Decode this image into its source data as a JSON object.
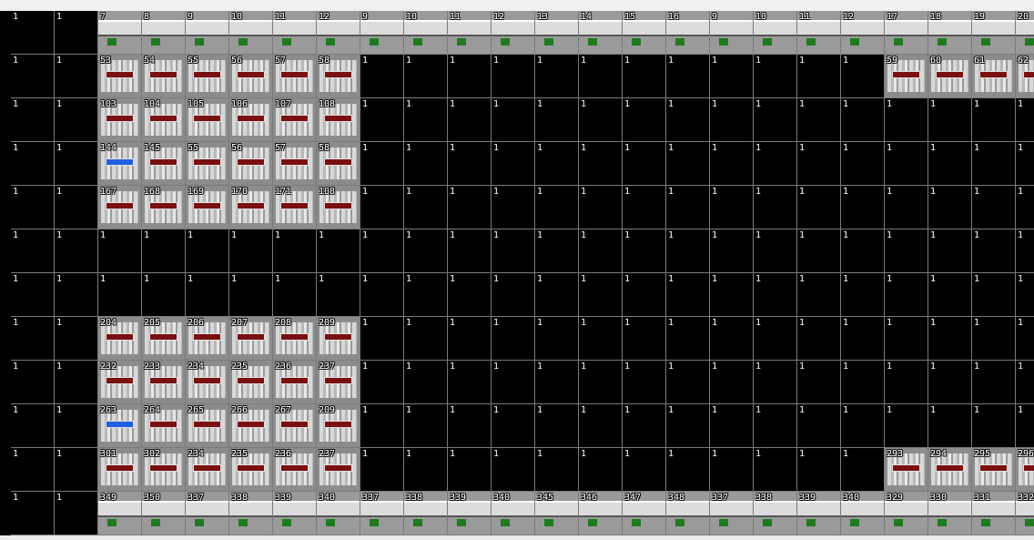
{
  "map": {
    "columns": 24,
    "rows": 12,
    "tiles": [
      [
        "1",
        "1",
        "7",
        "8",
        "9",
        "10",
        "11",
        "12",
        "9",
        "10",
        "11",
        "12",
        "13",
        "14",
        "15",
        "16",
        "9",
        "10",
        "11",
        "12",
        "17",
        "18",
        "19",
        "20"
      ],
      [
        "1",
        "1",
        "53",
        "54",
        "55",
        "56",
        "57",
        "58",
        "1",
        "1",
        "1",
        "1",
        "1",
        "1",
        "1",
        "1",
        "1",
        "1",
        "1",
        "1",
        "59",
        "60",
        "61",
        "62"
      ],
      [
        "1",
        "1",
        "103",
        "104",
        "105",
        "106",
        "107",
        "108",
        "1",
        "1",
        "1",
        "1",
        "1",
        "1",
        "1",
        "1",
        "1",
        "1",
        "1",
        "1",
        "1",
        "1",
        "1",
        "1"
      ],
      [
        "1",
        "1",
        "144",
        "145",
        "55",
        "56",
        "57",
        "58",
        "1",
        "1",
        "1",
        "1",
        "1",
        "1",
        "1",
        "1",
        "1",
        "1",
        "1",
        "1",
        "1",
        "1",
        "1",
        "1"
      ],
      [
        "1",
        "1",
        "167",
        "168",
        "169",
        "170",
        "171",
        "108",
        "1",
        "1",
        "1",
        "1",
        "1",
        "1",
        "1",
        "1",
        "1",
        "1",
        "1",
        "1",
        "1",
        "1",
        "1",
        "1"
      ],
      [
        "1",
        "1",
        "1",
        "1",
        "1",
        "1",
        "1",
        "1",
        "1",
        "1",
        "1",
        "1",
        "1",
        "1",
        "1",
        "1",
        "1",
        "1",
        "1",
        "1",
        "1",
        "1",
        "1",
        "1"
      ],
      [
        "1",
        "1",
        "1",
        "1",
        "1",
        "1",
        "1",
        "1",
        "1",
        "1",
        "1",
        "1",
        "1",
        "1",
        "1",
        "1",
        "1",
        "1",
        "1",
        "1",
        "1",
        "1",
        "1",
        "1"
      ],
      [
        "1",
        "1",
        "204",
        "205",
        "206",
        "207",
        "208",
        "209",
        "1",
        "1",
        "1",
        "1",
        "1",
        "1",
        "1",
        "1",
        "1",
        "1",
        "1",
        "1",
        "1",
        "1",
        "1",
        "1"
      ],
      [
        "1",
        "1",
        "232",
        "233",
        "234",
        "235",
        "236",
        "237",
        "1",
        "1",
        "1",
        "1",
        "1",
        "1",
        "1",
        "1",
        "1",
        "1",
        "1",
        "1",
        "1",
        "1",
        "1",
        "1"
      ],
      [
        "1",
        "1",
        "263",
        "264",
        "265",
        "266",
        "267",
        "209",
        "1",
        "1",
        "1",
        "1",
        "1",
        "1",
        "1",
        "1",
        "1",
        "1",
        "1",
        "1",
        "1",
        "1",
        "1",
        "1"
      ],
      [
        "1",
        "1",
        "301",
        "302",
        "234",
        "235",
        "236",
        "237",
        "1",
        "1",
        "1",
        "1",
        "1",
        "1",
        "1",
        "1",
        "1",
        "1",
        "1",
        "1",
        "293",
        "294",
        "295",
        "296"
      ],
      [
        "1",
        "1",
        "349",
        "350",
        "337",
        "338",
        "339",
        "340",
        "337",
        "338",
        "339",
        "340",
        "345",
        "346",
        "347",
        "348",
        "337",
        "338",
        "339",
        "340",
        "329",
        "330",
        "331",
        "332"
      ]
    ]
  },
  "colors": {
    "background": "#000000",
    "grid": "#7a7a7a",
    "hull": "#9a9a9a",
    "accent_red": "#7a1010",
    "accent_green": "#1f7a1f",
    "accent_blue": "#2060e0"
  }
}
